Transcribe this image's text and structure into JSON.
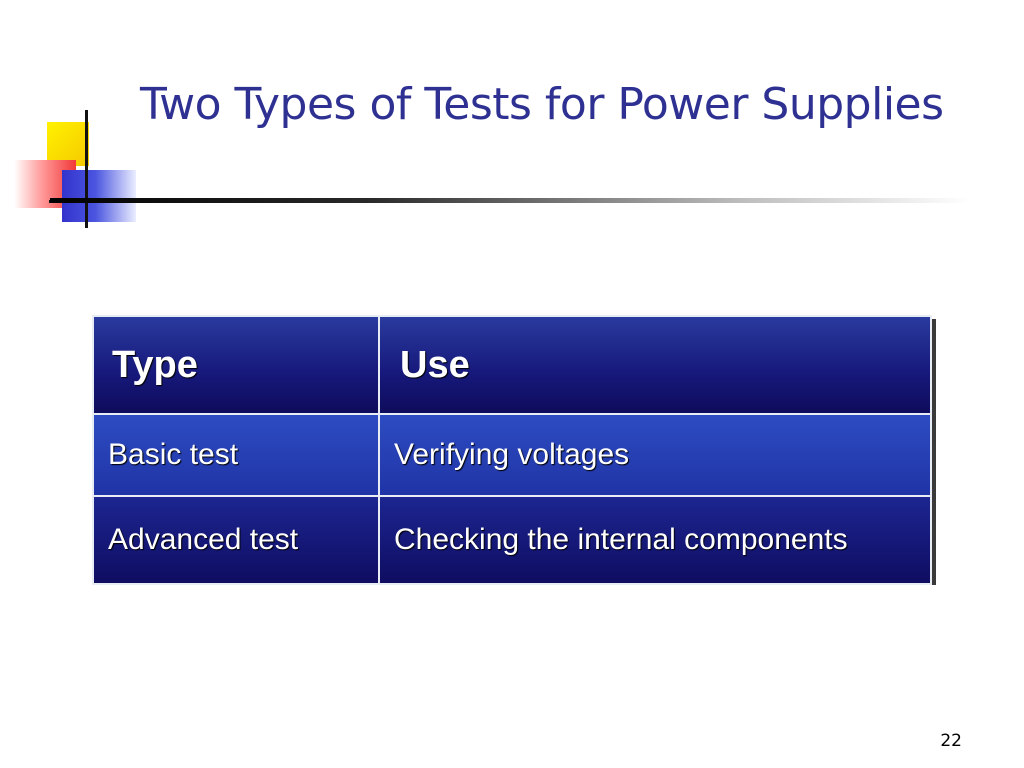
{
  "slide": {
    "title": "Two Types of Tests for Power Supplies",
    "page_number": "22"
  },
  "table": {
    "headers": [
      "Type",
      "Use"
    ],
    "rows": [
      [
        "Basic test",
        "Verifying voltages"
      ],
      [
        "Advanced test",
        "Checking the internal components"
      ]
    ]
  },
  "colors": {
    "title": "#2e3192",
    "header_bg": "#16187a",
    "row_light_bg": "#1f34a6",
    "row_dark_bg": "#0f0d62"
  }
}
